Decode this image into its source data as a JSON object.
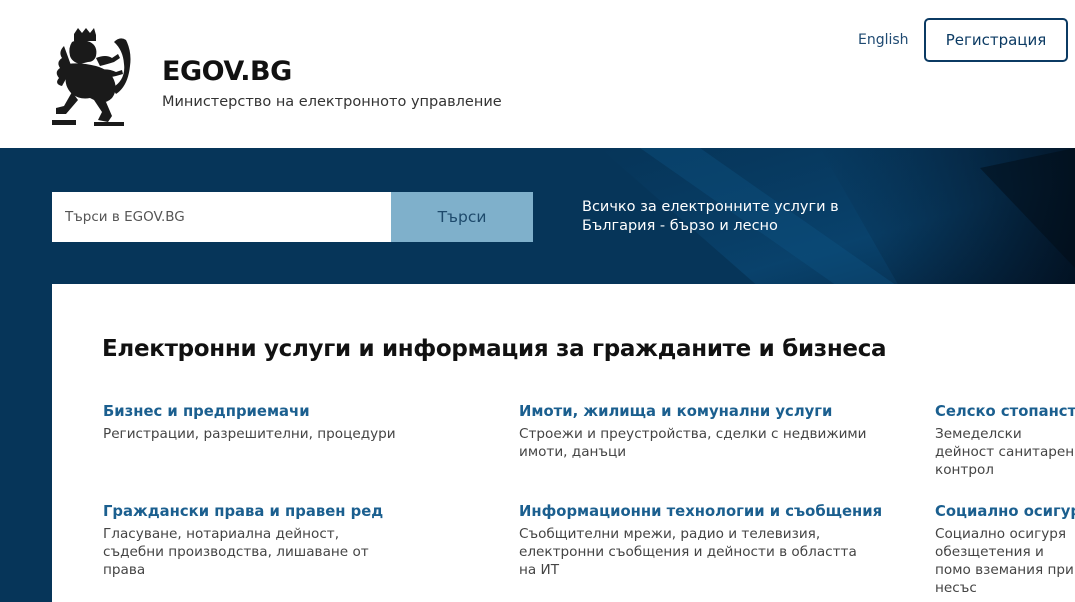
{
  "header": {
    "site_title": "EGOV.BG",
    "site_subtitle": "Министерство на електронното управление",
    "language_link": "English",
    "register_button": "Регистрация"
  },
  "hero": {
    "search_placeholder": "Търси в EGOV.BG",
    "search_button": "Търси",
    "tagline": "Всичко за електронните услуги в България - бързо и лесно"
  },
  "content": {
    "section_title": "Електронни услуги и информация за гражданите и бизнеса",
    "categories": [
      {
        "title": "Бизнес и предприемачи",
        "description": "Регистрации, разрешителни, процедури"
      },
      {
        "title": "Имоти, жилища и комунални услуги",
        "description": "Строежи и преустройства, сделки с недвижими имоти, данъци"
      },
      {
        "title": "Селско стопанство",
        "description": "Земеделски дейност санитарен контрол"
      },
      {
        "title": "Граждански права и правен ред",
        "description": "Гласуване, нотариална дейност, съдебни производства, лишаване от права"
      },
      {
        "title": "Информационни технологии и съобщения",
        "description": "Съобщителни мрежи, радио и телевизия, електронни съобщения и дейности в областта на ИТ"
      },
      {
        "title": "Социално осигуря",
        "description": "Социално осигуря обезщетения и помо вземания при несъс"
      }
    ]
  },
  "colors": {
    "hero_background": "#063559",
    "search_button": "#7fb0cb",
    "link_blue": "#1b5f8f",
    "register_border": "#0b3a63"
  },
  "icons": {
    "logo": "bulgarian-lion-coat-of-arms"
  }
}
